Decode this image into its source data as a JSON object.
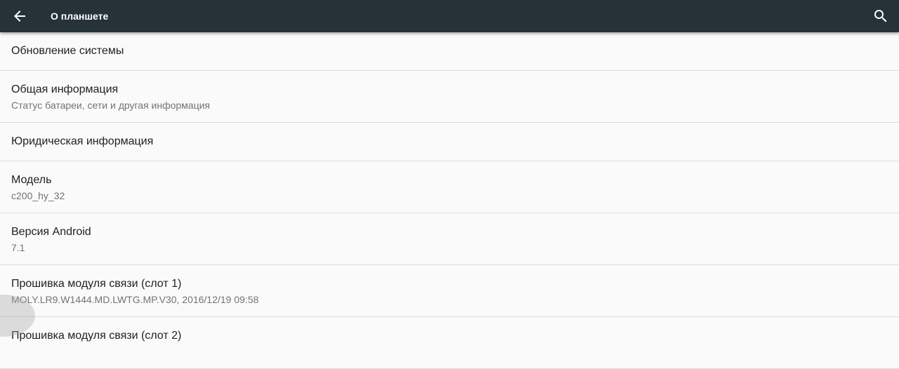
{
  "appbar": {
    "title": "О планшете",
    "back_icon": "arrow-back-icon",
    "search_icon": "search-icon",
    "background": "#263238"
  },
  "items": [
    {
      "title": "Обновление системы",
      "summary": ""
    },
    {
      "title": "Общая информация",
      "summary": "Статус батареи, сети и другая информация"
    },
    {
      "title": "Юридическая информация",
      "summary": ""
    },
    {
      "title": "Модель",
      "summary": "c200_hy_32"
    },
    {
      "title": "Версия Android",
      "summary": "7.1"
    },
    {
      "title": "Прошивка модуля связи  (слот 1)",
      "summary": "MOLY.LR9.W1444.MD.LWTG.MP.V30, 2016/12/19 09:58"
    },
    {
      "title": "Прошивка модуля связи  (слот 2)",
      "summary": ""
    }
  ]
}
